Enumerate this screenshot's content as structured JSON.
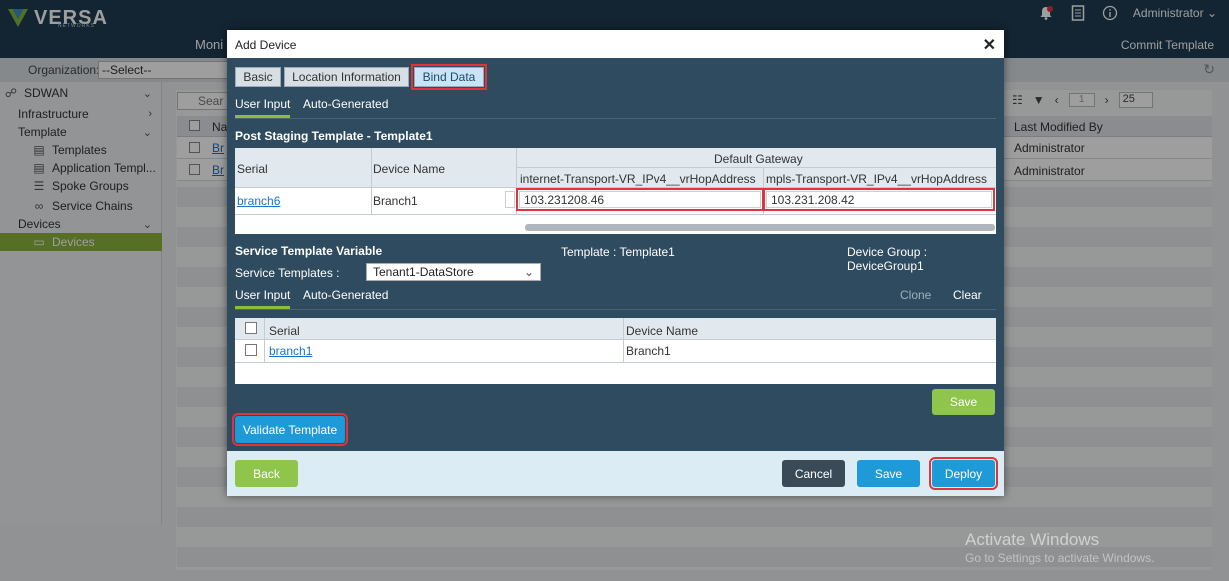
{
  "app": {
    "logo_text": "VERSA",
    "logo_sub": "NETWORKS",
    "user": "Administrator",
    "nav_partial": "Moni",
    "commit_template": "Commit Template",
    "organization_label": "Organization:",
    "organization_value": "--Select--",
    "notification_count": "0"
  },
  "sidebar": {
    "items": [
      {
        "label": "SDWAN"
      },
      {
        "label": "Infrastructure"
      },
      {
        "label": "Template"
      },
      {
        "label": "Templates"
      },
      {
        "label": "Application Templ..."
      },
      {
        "label": "Spoke Groups"
      },
      {
        "label": "Service Chains"
      },
      {
        "label": "Devices"
      },
      {
        "label": "Devices"
      }
    ]
  },
  "background_table": {
    "search_placeholder": "Sear",
    "col_name_partial": "Na",
    "col_last_modified": "Last Modified By",
    "row_name_partial": "Br",
    "rows": [
      "Administrator",
      "Administrator"
    ],
    "page_value": "1",
    "page_size": "25"
  },
  "modal": {
    "title": "Add Device",
    "tabs": [
      "Basic",
      "Location Information",
      "Bind Data"
    ],
    "subtabs": [
      "User Input",
      "Auto-Generated"
    ],
    "post_staging_title": "Post Staging Template - Template1",
    "grid1": {
      "col_serial": "Serial",
      "col_device_name": "Device Name",
      "group_header": "Default Gateway",
      "col_internet": "internet-Transport-VR_IPv4__vrHopAddress",
      "col_mpls": "mpls-Transport-VR_IPv4__vrHopAddress",
      "row": {
        "serial": "branch6",
        "device_name": "Branch1",
        "internet_value": "103.231208.46",
        "mpls_value": "103.231.208.42"
      }
    },
    "service_template_variable": "Service Template Variable",
    "template_label": "Template : Template1",
    "device_group_label": "Device Group : DeviceGroup1",
    "service_templates_label": "Service Templates :",
    "service_templates_value": "Tenant1-DataStore",
    "subtabs2": [
      "User Input",
      "Auto-Generated"
    ],
    "clone_label": "Clone",
    "clear_label": "Clear",
    "grid2": {
      "col_serial": "Serial",
      "col_device_name": "Device Name",
      "row": {
        "serial": "branch1",
        "device_name": "Branch1"
      }
    },
    "save_inner": "Save",
    "validate_template": "Validate Template",
    "back": "Back",
    "cancel": "Cancel",
    "save": "Save",
    "deploy": "Deploy"
  },
  "watermark": {
    "line1": "Activate Windows",
    "line2": "Go to Settings to activate Windows."
  }
}
